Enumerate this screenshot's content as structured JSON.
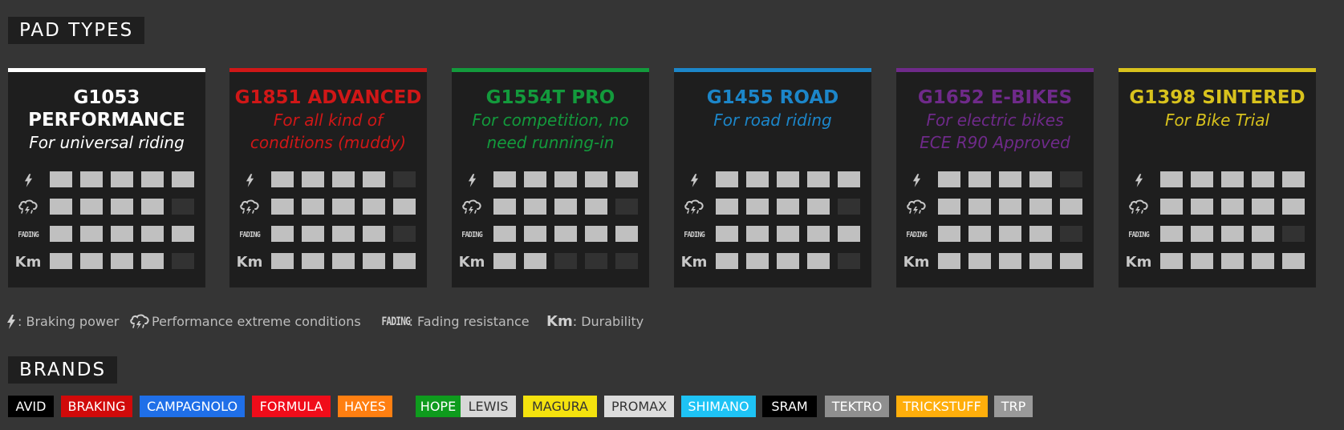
{
  "sections": {
    "pad_types": "PAD TYPES",
    "brands": "BRANDS"
  },
  "cards": [
    {
      "title1": "G1053",
      "title2": "PERFORMANCE",
      "sub1": "For universal riding",
      "sub2": "",
      "color": "#ffffff",
      "ratings": {
        "power": 5,
        "extreme": 4,
        "fading": 5,
        "durability": 4
      }
    },
    {
      "title1": "G1851 ADVANCED",
      "title2": "",
      "sub1": "For all kind of",
      "sub2": "conditions (muddy)",
      "color": "#d01717",
      "ratings": {
        "power": 4,
        "extreme": 5,
        "fading": 4,
        "durability": 5
      }
    },
    {
      "title1": "G1554T PRO",
      "title2": "",
      "sub1": "For competition, no",
      "sub2": "need running-in",
      "color": "#139a3c",
      "ratings": {
        "power": 5,
        "extreme": 4,
        "fading": 5,
        "durability": 2
      }
    },
    {
      "title1": "G1455 ROAD",
      "title2": "",
      "sub1": "For road riding",
      "sub2": "",
      "color": "#1c86c9",
      "ratings": {
        "power": 5,
        "extreme": 4,
        "fading": 5,
        "durability": 4
      }
    },
    {
      "title1": "G1652 E-BIKES",
      "title2": "",
      "sub1": "For electric bikes",
      "sub2": "ECE R90 Approved",
      "color": "#6f2a8a",
      "ratings": {
        "power": 4,
        "extreme": 5,
        "fading": 4,
        "durability": 5
      }
    },
    {
      "title1": "G1398 SINTERED",
      "title2": "",
      "sub1": "For Bike Trial",
      "sub2": "",
      "color": "#d8c21d",
      "ratings": {
        "power": 5,
        "extreme": 5,
        "fading": 4,
        "durability": 5
      }
    }
  ],
  "rating_labels": {
    "fading": "FADING",
    "km": "Km"
  },
  "legend": {
    "power": ": Braking power",
    "extreme": "Performance extreme conditions",
    "fading_icon": "FADING",
    "fading": ": Fading resistance",
    "km_icon": "Km",
    "km": ": Durability"
  },
  "icons": {
    "power": "lightning-icon",
    "extreme": "storm-cloud-icon"
  },
  "brands": [
    {
      "name": "AVID",
      "bg": "#000000",
      "fg": "#ffffff"
    },
    {
      "name": "BRAKING",
      "bg": "#d10a0a",
      "fg": "#ffffff"
    },
    {
      "name": "CAMPAGNOLO",
      "bg": "#1f6fe8",
      "fg": "#ffffff"
    },
    {
      "name": "FORMULA",
      "bg": "#f00c1a",
      "fg": "#ffffff"
    },
    {
      "name": "HAYES",
      "bg": "#ff7f11",
      "fg": "#ffffff"
    },
    {
      "name": "HOPE",
      "bg": "#0e9b1d",
      "fg": "#ffffff"
    },
    {
      "name": "LEWIS",
      "bg": "#d7d7d7",
      "fg": "#333333"
    },
    {
      "name": "MAGURA",
      "bg": "#f4e20e",
      "fg": "#333333"
    },
    {
      "name": "PROMAX",
      "bg": "#dcdcdc",
      "fg": "#333333"
    },
    {
      "name": "SHIMANO",
      "bg": "#1ec3f5",
      "fg": "#ffffff"
    },
    {
      "name": "SRAM",
      "bg": "#000000",
      "fg": "#ffffff"
    },
    {
      "name": "TEKTRO",
      "bg": "#8f8f8f",
      "fg": "#ffffff"
    },
    {
      "name": "TRICKSTUFF",
      "bg": "#ffae0b",
      "fg": "#ffffff"
    },
    {
      "name": "TRP",
      "bg": "#9a9a9a",
      "fg": "#ffffff"
    }
  ]
}
